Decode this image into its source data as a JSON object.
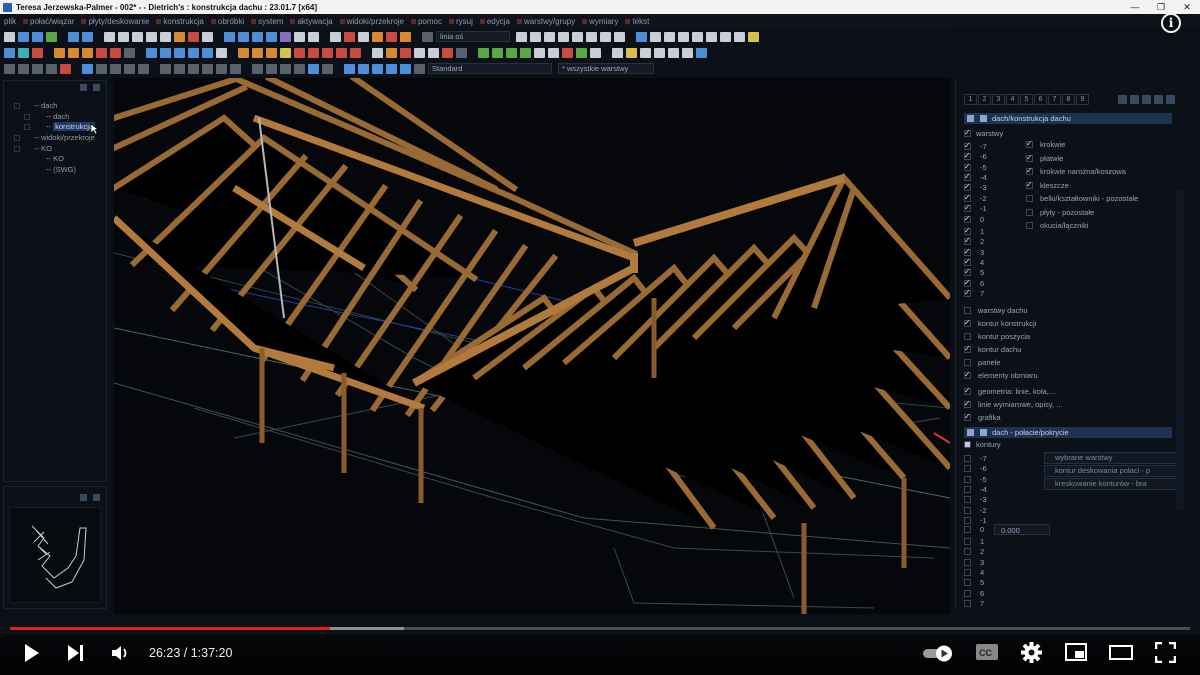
{
  "window": {
    "title": "Teresa Jerzewska-Palmer - 002* -  - Dietrich's : konstrukcja dachu : 23.01.7 [x64]",
    "controls": [
      "—",
      "❐",
      "✕"
    ]
  },
  "menu": [
    "plik",
    "połać/wiązar",
    "płyty/deskowanie",
    "konstrukcja",
    "obróbki",
    "system",
    "aktywacja",
    "widoki/przekroje",
    "pomoc",
    "rysuj",
    "edycja",
    "warstwy/grupy",
    "wymiary",
    "tekst"
  ],
  "toolbar": {
    "line_type": "linia oś",
    "style": "Standard",
    "layers": "* wszystkie warstwy"
  },
  "tree": [
    {
      "label": "dach",
      "level": 0
    },
    {
      "label": "dach",
      "level": 1
    },
    {
      "label": "konstrukcja",
      "level": 1,
      "selected": true
    },
    {
      "label": "widoki/przekroje",
      "level": 0
    },
    {
      "label": "KO",
      "level": 0
    },
    {
      "label": "KO",
      "level": 1
    },
    {
      "label": "(SWG)",
      "level": 1
    }
  ],
  "right_panel": {
    "tabs": [
      "1",
      "2",
      "3",
      "4",
      "5",
      "6",
      "7",
      "8",
      "9"
    ],
    "group1_title": "dach/konstrukcja dachu",
    "layers_label": "warstwy",
    "levels_neg": [
      "-7",
      "-6",
      "-5",
      "-4",
      "-3",
      "-2",
      "-1"
    ],
    "level_zero": "0",
    "levels_pos": [
      "1",
      "2",
      "3",
      "4",
      "5",
      "6",
      "7"
    ],
    "elements": [
      {
        "label": "krokwie",
        "checked": true
      },
      {
        "label": "płatwie",
        "checked": true
      },
      {
        "label": "krokwie narożna/koszowa",
        "checked": true
      },
      {
        "label": "kleszcze",
        "checked": true
      },
      {
        "label": "belki/kształtowniki - pozostałe",
        "checked": false
      },
      {
        "label": "płyty - pozostałe",
        "checked": false
      },
      {
        "label": "okucia/łączniki",
        "checked": false
      }
    ],
    "options": [
      {
        "label": "warstwy dachu",
        "checked": false
      },
      {
        "label": "kontur konstrukcji",
        "checked": true
      },
      {
        "label": "kontur poszycia",
        "checked": false
      },
      {
        "label": "kontur dachu",
        "checked": true
      },
      {
        "label": "panele",
        "checked": false
      },
      {
        "label": "elementy obmiaru",
        "checked": true
      },
      {
        "label": "geometria: linie, koła,...",
        "checked": true
      },
      {
        "label": "linie wymiarowe, opisy, ...",
        "checked": true
      },
      {
        "label": "grafika",
        "checked": true
      }
    ],
    "group2_title": "dach - połacie/pokrycie",
    "contours_label": "kontury",
    "zero_value": "0.000",
    "group2_fields": [
      "wybrane warstwy",
      "kontur deskowania połaci - p",
      "kreskowanie konturów - bra"
    ]
  },
  "video": {
    "current_time": "26:23",
    "duration": "1:37:20",
    "progress_fraction": 0.271,
    "buffered_fraction": 0.334,
    "progress_color": "#e51d1d"
  }
}
